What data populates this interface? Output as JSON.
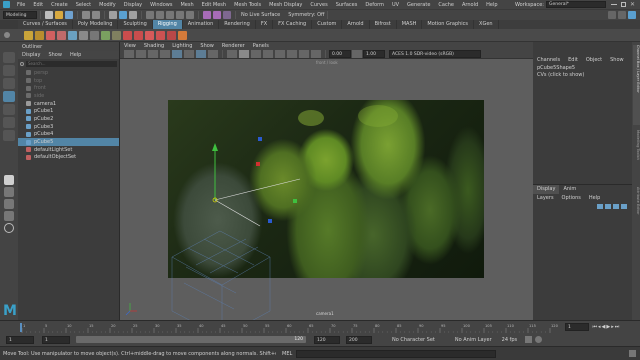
{
  "window": {
    "menus": [
      "File",
      "Edit",
      "Create",
      "Select",
      "Modify",
      "Display",
      "Windows",
      "Mesh",
      "Edit Mesh",
      "Mesh Tools",
      "Mesh Display",
      "Curves",
      "Surfaces",
      "Deform",
      "UV",
      "Generate",
      "Cache",
      "Arnold",
      "Help"
    ],
    "workspace_label": "Workspace:",
    "workspace_value": "General*"
  },
  "status_line": {
    "mode_menu": "Modeling",
    "live_surface": "No Live Surface",
    "symmetry": "Symmetry: Off"
  },
  "shelf_tabs": [
    "Curves / Surfaces",
    "Poly Modeling",
    "Sculpting",
    "Rigging",
    "Animation",
    "Rendering",
    "FX",
    "FX Caching",
    "Custom",
    "Arnold",
    "Bifrost",
    "MASH",
    "Motion Graphics",
    "XGen"
  ],
  "shelf_active_index": 3,
  "outliner": {
    "title": "Outliner",
    "menus": [
      "Display",
      "Show",
      "Help"
    ],
    "search_placeholder": "Search...",
    "items": [
      {
        "label": "persp",
        "dim": true
      },
      {
        "label": "top",
        "dim": true
      },
      {
        "label": "front",
        "dim": true
      },
      {
        "label": "side",
        "dim": true
      },
      {
        "label": "camera1",
        "dim": false
      },
      {
        "label": "pCube1",
        "dim": false
      },
      {
        "label": "pCube2",
        "dim": false
      },
      {
        "label": "pCube3",
        "dim": false
      },
      {
        "label": "pCube4",
        "dim": false
      },
      {
        "label": "pCube5",
        "dim": false,
        "selected": true
      },
      {
        "label": "defaultLightSet",
        "dim": false
      },
      {
        "label": "defaultObjectSet",
        "dim": false
      }
    ]
  },
  "viewport": {
    "menus": [
      "View",
      "Shading",
      "Lighting",
      "Show",
      "Renderer",
      "Panels"
    ],
    "exposure": "0.00",
    "gamma": "1.00",
    "colorspace": "ACES 1.0 SDR-video (sRGB)",
    "camera_label": "camera1",
    "top_label": "front / look"
  },
  "channel_box": {
    "menus": [
      "Channels",
      "Edit",
      "Object",
      "Show"
    ],
    "node": "pCube5Shape5",
    "hint": "CVs (click to show)",
    "side_tabs": [
      "Channel Box / Layer Editor",
      "Modelling Toolkit",
      "Attribute Editor"
    ]
  },
  "layer_editor": {
    "tabs": [
      "Display",
      "Anim"
    ],
    "menus": [
      "Layers",
      "Options",
      "Help"
    ]
  },
  "time_slider": {
    "ticks": [
      "1",
      "5",
      "10",
      "15",
      "20",
      "25",
      "30",
      "35",
      "40",
      "45",
      "50",
      "55",
      "60",
      "65",
      "70",
      "75",
      "80",
      "85",
      "90",
      "95",
      "100",
      "105",
      "110",
      "115",
      "120"
    ],
    "current_frame": "1"
  },
  "range_slider": {
    "start": "1",
    "start_inner": "1",
    "range_label": "120",
    "end_inner": "120",
    "end": "200",
    "character_set": "No Character Set",
    "anim_layer": "No Anim Layer",
    "fps": "24 fps"
  },
  "help_line": {
    "text": "Move Tool: Use manipulator to move object(s). Ctrl+middle-drag to move components along normals. Shift+drag manipulator axis or plan",
    "mel_label": "MEL"
  },
  "colors": {
    "accent": "#5285a6",
    "ui_bg": "#444444",
    "panel_bg": "#3c3c3c",
    "viewport_bg": "#5e5e5e"
  }
}
